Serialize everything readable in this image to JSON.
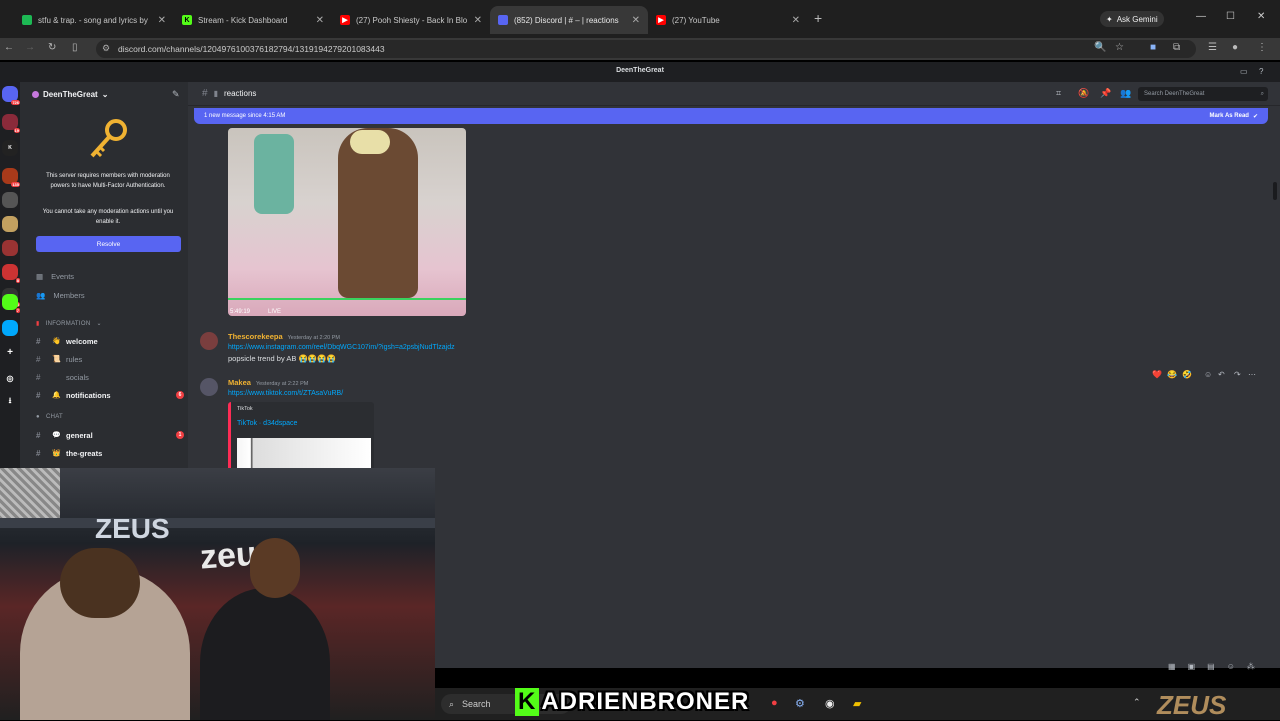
{
  "browser": {
    "tabs": [
      {
        "title": "stfu & trap. - song and lyrics by",
        "favicon_color": "#1db954"
      },
      {
        "title": "Stream - Kick Dashboard",
        "favicon_color": "#53fc18"
      },
      {
        "title": "(27) Pooh Shiesty - Back In Blo",
        "favicon_color": "#ff0000"
      },
      {
        "title": "(852) Discord | # – | reactions",
        "favicon_color": "#5865f2"
      },
      {
        "title": "(27) YouTube",
        "favicon_color": "#ff0000"
      }
    ],
    "ask_gemini": "Ask Gemini",
    "url": "discord.com/channels/1204976100376182794/1319194279201083443"
  },
  "discord": {
    "top_title": "DeenTheGreat",
    "guild_name": "DeenTheGreat",
    "mfa_notice": "This server requires members with moderation powers to have Multi-Factor Authentication.",
    "mfa_notice2": "You cannot take any moderation actions until you enable it.",
    "resolve_label": "Resolve",
    "events_label": "Events",
    "members_label": "Members",
    "category_information": "INFORMATION",
    "category_chat": "CHAT",
    "channels": [
      {
        "name": "welcome",
        "emoji": "👋",
        "bold": true,
        "mention": ""
      },
      {
        "name": "rules",
        "emoji": "📜",
        "bold": false,
        "mention": ""
      },
      {
        "name": "socials",
        "emoji": "",
        "bold": false,
        "mention": ""
      },
      {
        "name": "notifications",
        "emoji": "🔔",
        "bold": true,
        "mention": "6"
      }
    ],
    "chat_channels": [
      {
        "name": "general",
        "emoji": "💬",
        "bold": true,
        "mention": "1"
      },
      {
        "name": "the-greats",
        "emoji": "👑",
        "bold": true,
        "mention": ""
      }
    ],
    "current_channel": "reactions",
    "search_placeholder": "Search DeenTheGreat",
    "new_messages_text": "1 new message since 4:15 AM",
    "mark_as_read": "Mark As Read",
    "video": {
      "time": "5:49:19",
      "live": "LIVE"
    },
    "messages": [
      {
        "author": "Thescorekeepa",
        "author_color": "#f0b232",
        "timestamp": "Yesterday at 2:20 PM",
        "link": "https://www.instagram.com/reel/DbqWGC107im/?igsh=a2psbjNudTlzajdz",
        "text": "popsicle trend by AB 😭😭😭😭"
      },
      {
        "author": "Makea",
        "author_color": "#f0b232",
        "timestamp": "Yesterday at 2:22 PM",
        "link": "https://www.tiktok.com/t/ZTAsaVuRB/",
        "embed_provider": "TikTok",
        "embed_title": "TikTok · d34dspace"
      }
    ],
    "reactions": [
      "❤️",
      "😂",
      "🤣"
    ]
  },
  "taskbar": {
    "search_label": "Search",
    "overlay_name": "ADRIENBRONER",
    "overlay_prefix": "K",
    "brand": "ZEUS"
  },
  "webcam": {
    "wall_text": "ZEUS",
    "chair_text": "zeus"
  }
}
